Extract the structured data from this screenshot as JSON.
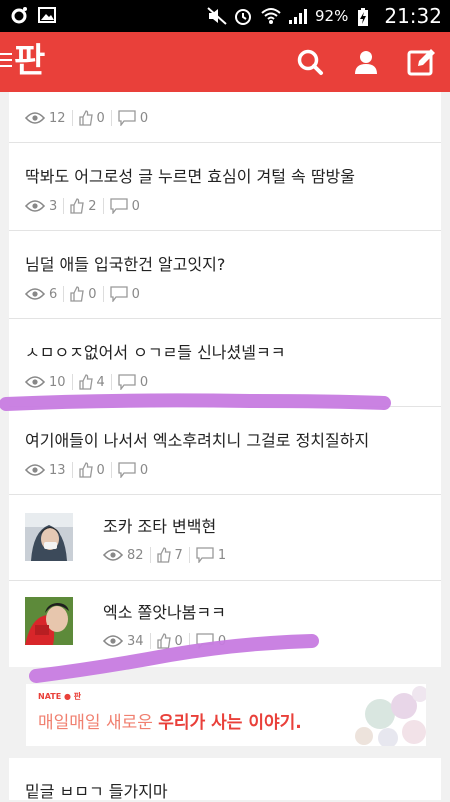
{
  "status_bar": {
    "battery": "92%",
    "time": "21:32"
  },
  "app": {
    "logo": "판"
  },
  "posts": [
    {
      "title": "",
      "views": "12",
      "likes": "0",
      "comments": "0"
    },
    {
      "title": "딱봐도 어그로성 글 누르면 효심이 겨털 속 땀방울",
      "views": "3",
      "likes": "2",
      "comments": "0"
    },
    {
      "title": "님덜 애들 입국한건 알고잇지?",
      "views": "6",
      "likes": "0",
      "comments": "0"
    },
    {
      "title": "ㅅㅁㅇㅈ없어서 ㅇㄱㄹ들 신나셨넬ㅋㅋ",
      "views": "10",
      "likes": "4",
      "comments": "0"
    },
    {
      "title": "여기애들이 나서서 엑소후려치니 그걸로 정치질하지",
      "views": "13",
      "likes": "0",
      "comments": "0"
    },
    {
      "title": "조카 조타 변백현",
      "views": "82",
      "likes": "7",
      "comments": "1"
    },
    {
      "title": "엑소 쫄앗나봄ㅋㅋ",
      "views": "34",
      "likes": "0",
      "comments": "0"
    },
    {
      "title": "밑글 ㅂㅁㄱ 들가지마",
      "views": "",
      "likes": "",
      "comments": ""
    }
  ],
  "banner": {
    "brand": "NATE ● 판",
    "text_plain": "매일매일 새로운 ",
    "text_strong": "우리가 사는 이야기."
  },
  "colors": {
    "brand_red": "#e9403a",
    "highlighter": "#c77be0"
  }
}
